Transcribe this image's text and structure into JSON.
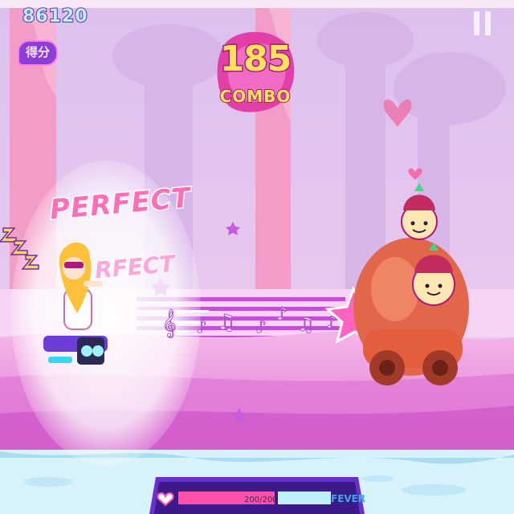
{
  "hud": {
    "score": "86120",
    "score_badge": "得分",
    "combo_count": "185",
    "combo_label": "COMBO",
    "judgement": "PERFECT",
    "judgement_echo": "RFECT"
  },
  "status_bar": {
    "hp_text": "200/200",
    "hp_fraction": 1.0,
    "fever_label": "FEVER",
    "fever_fraction": 0.0
  },
  "icons": {
    "pause": "pause-icon",
    "heart": "heart-icon",
    "sleep": "zzz-icon",
    "notes": "music-note-icon"
  },
  "colors": {
    "sky": "#e9c8f2",
    "trees": "#ef9fc6",
    "track": "#b24fd6",
    "ground": "#f2a9e6",
    "water": "#d8f2fb",
    "combo_fill": "#ffe15a",
    "perfect_pink": "#ff6fb8",
    "hp_bar": "#ff4fa8",
    "fever_bar": "#2fc9ff"
  }
}
